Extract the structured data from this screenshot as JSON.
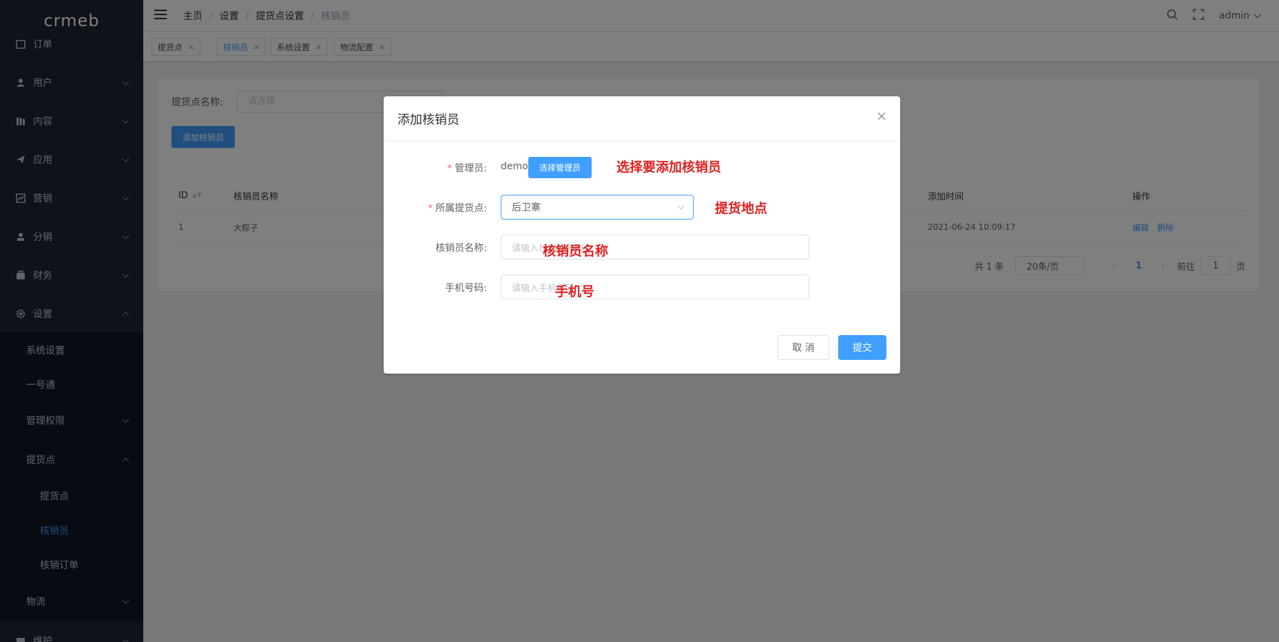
{
  "sidebar": {
    "logo": "crmeb",
    "items": [
      {
        "label": "订单",
        "icon": "order-icon"
      },
      {
        "label": "用户",
        "icon": "user-icon"
      },
      {
        "label": "内容",
        "icon": "content-icon"
      },
      {
        "label": "应用",
        "icon": "app-icon"
      },
      {
        "label": "营销",
        "icon": "marketing-icon"
      },
      {
        "label": "分销",
        "icon": "distribution-icon"
      },
      {
        "label": "财务",
        "icon": "finance-icon"
      },
      {
        "label": "设置",
        "icon": "gear-icon"
      }
    ],
    "settings_children": [
      "系统设置",
      "一号通",
      "管理权限",
      "提货点"
    ],
    "pickup_children": [
      "提货点",
      "核销员",
      "核销订单"
    ],
    "logistics": "物流",
    "maintenance": "维护"
  },
  "header": {
    "breadcrumb": [
      "主页",
      "设置",
      "提货点设置",
      "核销员"
    ],
    "user": "admin"
  },
  "tags": [
    {
      "label": "提货点"
    },
    {
      "label": "核销员"
    },
    {
      "label": "系统设置"
    },
    {
      "label": "物流配置"
    }
  ],
  "filter": {
    "label": "提货点名称:",
    "placeholder": "请选择",
    "add_button": "添加核销员"
  },
  "table": {
    "headers": {
      "id": "ID",
      "name": "核销员名称",
      "time": "添加时间",
      "ops": "操作"
    },
    "rows": [
      {
        "id": "1",
        "name": "大粽子",
        "time": "2021-06-24 10:09:17",
        "edit": "编辑",
        "delete": "删除"
      }
    ]
  },
  "pagination": {
    "total": "共 1 条",
    "page_size": "20条/页",
    "current": "1",
    "goto_label": "前往",
    "goto_value": "1",
    "page_suffix": "页"
  },
  "dialog": {
    "title": "添加核销员",
    "admin_label": "管理员:",
    "admin_value": "demo",
    "choose_admin": "选择管理员",
    "pickup_label": "所属提货点:",
    "pickup_value": "后卫寨",
    "name_label": "核销员名称:",
    "name_placeholder": "请输入核销员名称",
    "phone_label": "手机号码:",
    "phone_placeholder": "请输入手机号码",
    "cancel": "取 消",
    "submit": "提交"
  },
  "annotations": {
    "admin": "选择要添加核销员",
    "pickup": "提货地点",
    "name": "核销员名称",
    "phone": "手机号"
  },
  "colors": {
    "primary": "#409eff",
    "sidebar": "#1e2533",
    "annotation": "#e02020"
  }
}
